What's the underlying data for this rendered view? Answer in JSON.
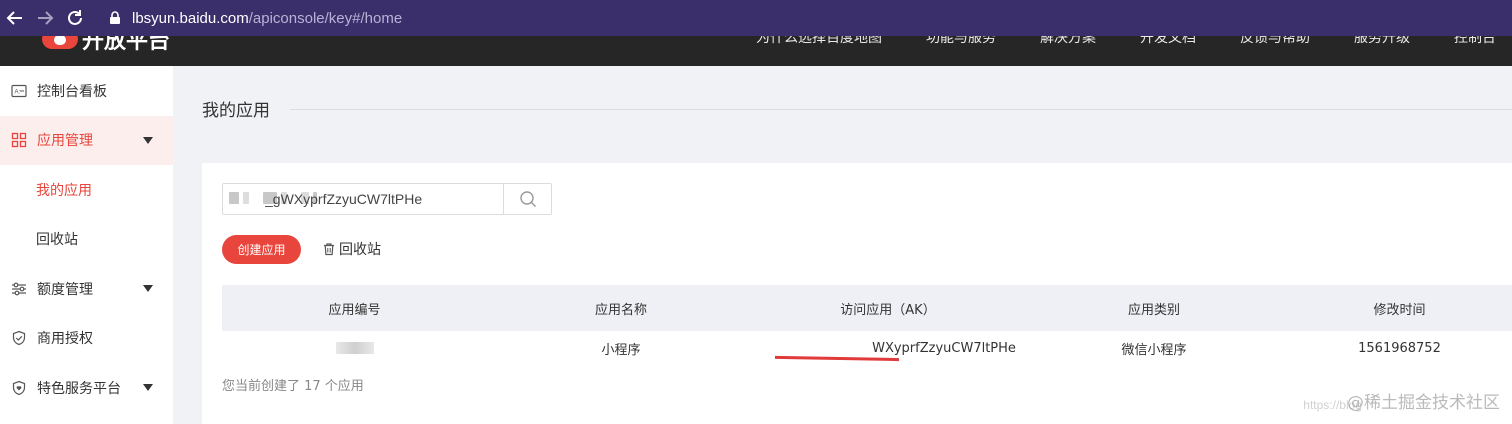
{
  "browser": {
    "url_host": "lbsyun.baidu.com",
    "url_path": "/apiconsole/key#/home"
  },
  "header": {
    "logo_text": "开放平台",
    "nav": [
      "为什么选择百度地图",
      "功能与服务",
      "解决方案",
      "开发文档",
      "反馈与帮助",
      "服务升级",
      "控制台"
    ]
  },
  "sidebar": {
    "items": [
      {
        "label": "控制台看板",
        "icon": "dashboard-icon"
      },
      {
        "label": "应用管理",
        "icon": "grid-icon"
      },
      {
        "label": "我的应用"
      },
      {
        "label": "回收站"
      },
      {
        "label": "额度管理",
        "icon": "sliders-icon"
      },
      {
        "label": "商用授权",
        "icon": "shield-check-icon"
      },
      {
        "label": "特色服务平台",
        "icon": "heart-shield-icon"
      }
    ]
  },
  "main": {
    "title": "我的应用",
    "search": {
      "value": "_gWXyprfZzyuCW7ltPHe"
    },
    "create_label": "创建应用",
    "recycle_label": "回收站",
    "table": {
      "headers": [
        "应用编号",
        "应用名称",
        "访问应用（AK）",
        "应用类别",
        "修改时间"
      ],
      "rows": [
        {
          "name": "小程序",
          "ak": "WXyprfZzyuCW7ltPHe",
          "category": "微信小程序",
          "modified": "1561968752"
        }
      ]
    },
    "footer": "您当前创建了 17 个应用"
  },
  "watermark": {
    "text": "@稀土掘金技术社区",
    "url": "https://blog"
  },
  "colors": {
    "accent": "#e8453c",
    "browser_bar": "#3a2f6b",
    "header_bg": "#262626"
  }
}
